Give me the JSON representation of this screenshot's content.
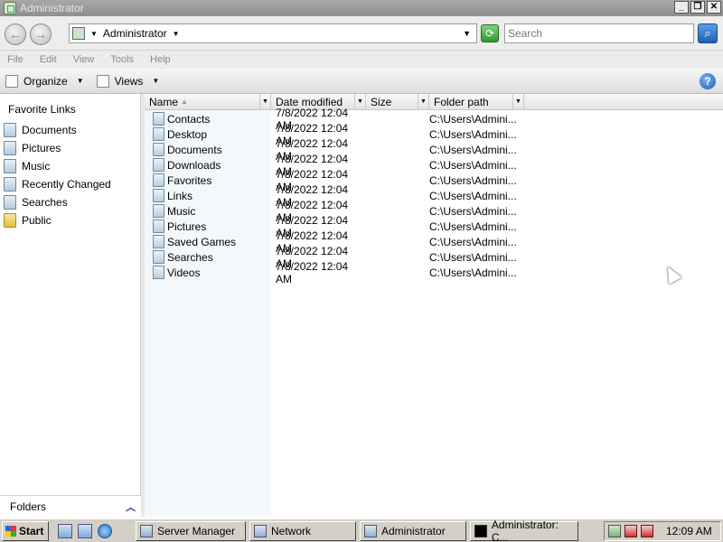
{
  "window": {
    "title": "Administrator"
  },
  "address": {
    "path": "Administrator",
    "search_placeholder": "Search"
  },
  "menu": [
    "File",
    "Edit",
    "View",
    "Tools",
    "Help"
  ],
  "toolbar": {
    "organize": "Organize",
    "views": "Views",
    "help": "?"
  },
  "favorites": {
    "header": "Favorite Links",
    "items": [
      {
        "label": "Documents",
        "icon": "documents-icon"
      },
      {
        "label": "Pictures",
        "icon": "pictures-icon"
      },
      {
        "label": "Music",
        "icon": "music-icon"
      },
      {
        "label": "Recently Changed",
        "icon": "recently-changed-icon"
      },
      {
        "label": "Searches",
        "icon": "searches-icon"
      },
      {
        "label": "Public",
        "icon": "folder-icon"
      }
    ],
    "folders_label": "Folders"
  },
  "columns": {
    "name": "Name",
    "date": "Date modified",
    "size": "Size",
    "path": "Folder path"
  },
  "files": [
    {
      "name": "Contacts",
      "date": "7/8/2022 12:04 AM",
      "size": "",
      "path": "C:\\Users\\Admini..."
    },
    {
      "name": "Desktop",
      "date": "7/8/2022 12:04 AM",
      "size": "",
      "path": "C:\\Users\\Admini..."
    },
    {
      "name": "Documents",
      "date": "7/8/2022 12:04 AM",
      "size": "",
      "path": "C:\\Users\\Admini..."
    },
    {
      "name": "Downloads",
      "date": "7/8/2022 12:04 AM",
      "size": "",
      "path": "C:\\Users\\Admini..."
    },
    {
      "name": "Favorites",
      "date": "7/8/2022 12:04 AM",
      "size": "",
      "path": "C:\\Users\\Admini..."
    },
    {
      "name": "Links",
      "date": "7/8/2022 12:04 AM",
      "size": "",
      "path": "C:\\Users\\Admini..."
    },
    {
      "name": "Music",
      "date": "7/8/2022 12:04 AM",
      "size": "",
      "path": "C:\\Users\\Admini..."
    },
    {
      "name": "Pictures",
      "date": "7/8/2022 12:04 AM",
      "size": "",
      "path": "C:\\Users\\Admini..."
    },
    {
      "name": "Saved Games",
      "date": "7/8/2022 12:04 AM",
      "size": "",
      "path": "C:\\Users\\Admini..."
    },
    {
      "name": "Searches",
      "date": "7/8/2022 12:04 AM",
      "size": "",
      "path": "C:\\Users\\Admini..."
    },
    {
      "name": "Videos",
      "date": "7/8/2022 12:04 AM",
      "size": "",
      "path": "C:\\Users\\Admini..."
    }
  ],
  "taskbar": {
    "start": "Start",
    "tasks": [
      {
        "label": "Server Manager",
        "icon": "server-manager-icon"
      },
      {
        "label": "Network",
        "icon": "network-icon"
      },
      {
        "label": "Administrator",
        "icon": "explorer-icon"
      },
      {
        "label": "Administrator: C...",
        "icon": "cmd-icon"
      }
    ],
    "clock": "12:09 AM"
  }
}
